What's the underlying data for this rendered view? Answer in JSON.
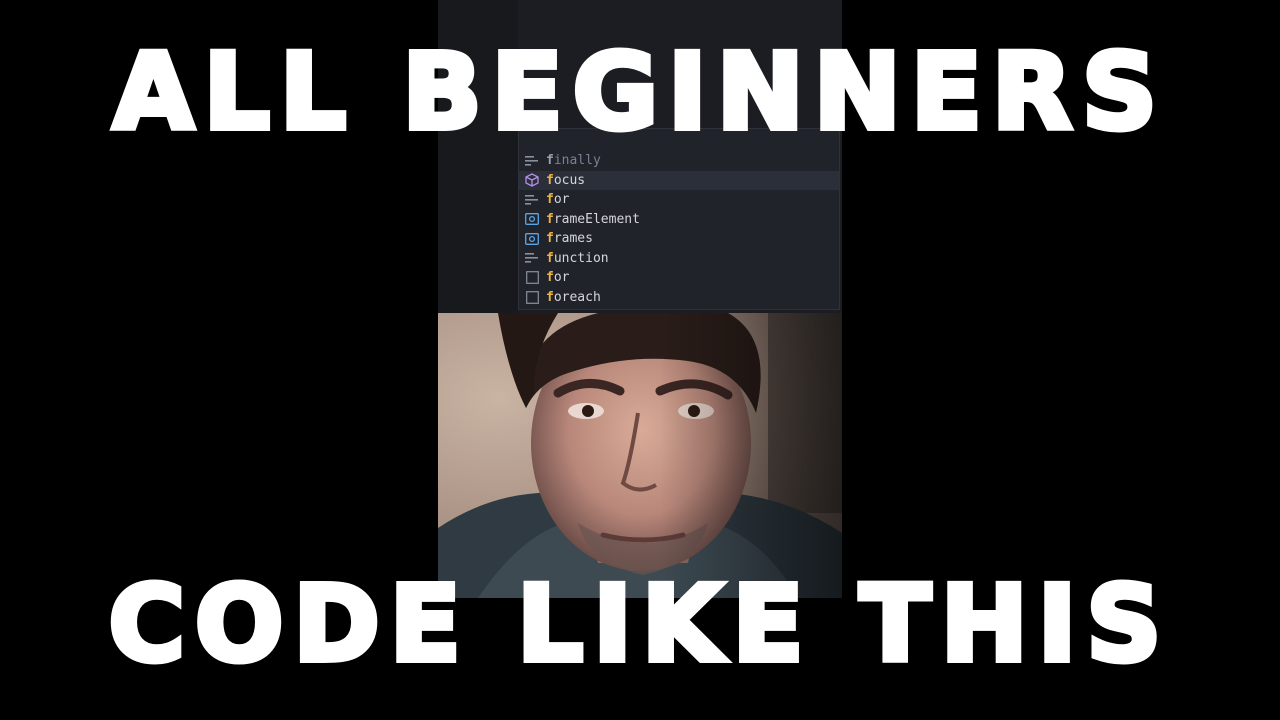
{
  "caption": {
    "top": "ALL BEGINNERS",
    "bottom": "CODE LIKE THIS",
    "color": "#ffffff"
  },
  "editor": {
    "background": "#1b1d22",
    "match_color": "#f0b341",
    "typed_prefix": "f",
    "suggestions": [
      {
        "match": "f",
        "rest": "inally",
        "icon": "keyword-snippet-icon",
        "state": "ghost"
      },
      {
        "match": "f",
        "rest": "ocus",
        "icon": "method-cube-icon",
        "state": "selected"
      },
      {
        "match": "f",
        "rest": "or",
        "icon": "keyword-snippet-icon",
        "state": "normal"
      },
      {
        "match": "f",
        "rest": "rameElement",
        "icon": "variable-icon",
        "state": "normal"
      },
      {
        "match": "f",
        "rest": "rames",
        "icon": "variable-icon",
        "state": "normal"
      },
      {
        "match": "f",
        "rest": "unction",
        "icon": "keyword-snippet-icon",
        "state": "normal"
      },
      {
        "match": "f",
        "rest": "or",
        "icon": "snippet-box-icon",
        "state": "normal"
      },
      {
        "match": "f",
        "rest": "oreach",
        "icon": "snippet-box-icon",
        "state": "normal"
      }
    ]
  },
  "webcam": {
    "description_icon": "webcam-photo"
  }
}
